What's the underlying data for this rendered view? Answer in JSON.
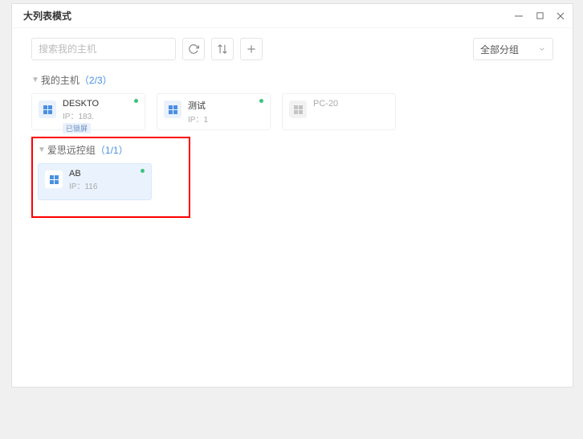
{
  "window": {
    "title": "大列表模式"
  },
  "toolbar": {
    "search_placeholder": "搜索我的主机",
    "group_filter": "全部分组"
  },
  "sections": [
    {
      "label": "我的主机",
      "count_text": "（2/3）",
      "cards": [
        {
          "name": "DESKTO",
          "ip": "IP：183.",
          "badge": "已锁屏",
          "online": true
        },
        {
          "name": "测试",
          "ip": "IP：1",
          "online": true
        },
        {
          "name": "PC-20",
          "ip": "",
          "online": false
        }
      ]
    },
    {
      "label": "爱思远控组",
      "count_text": "（1/1）",
      "highlighted": true,
      "cards": [
        {
          "name": "AB",
          "ip": "IP：116",
          "online": true,
          "selected": true
        }
      ]
    }
  ]
}
